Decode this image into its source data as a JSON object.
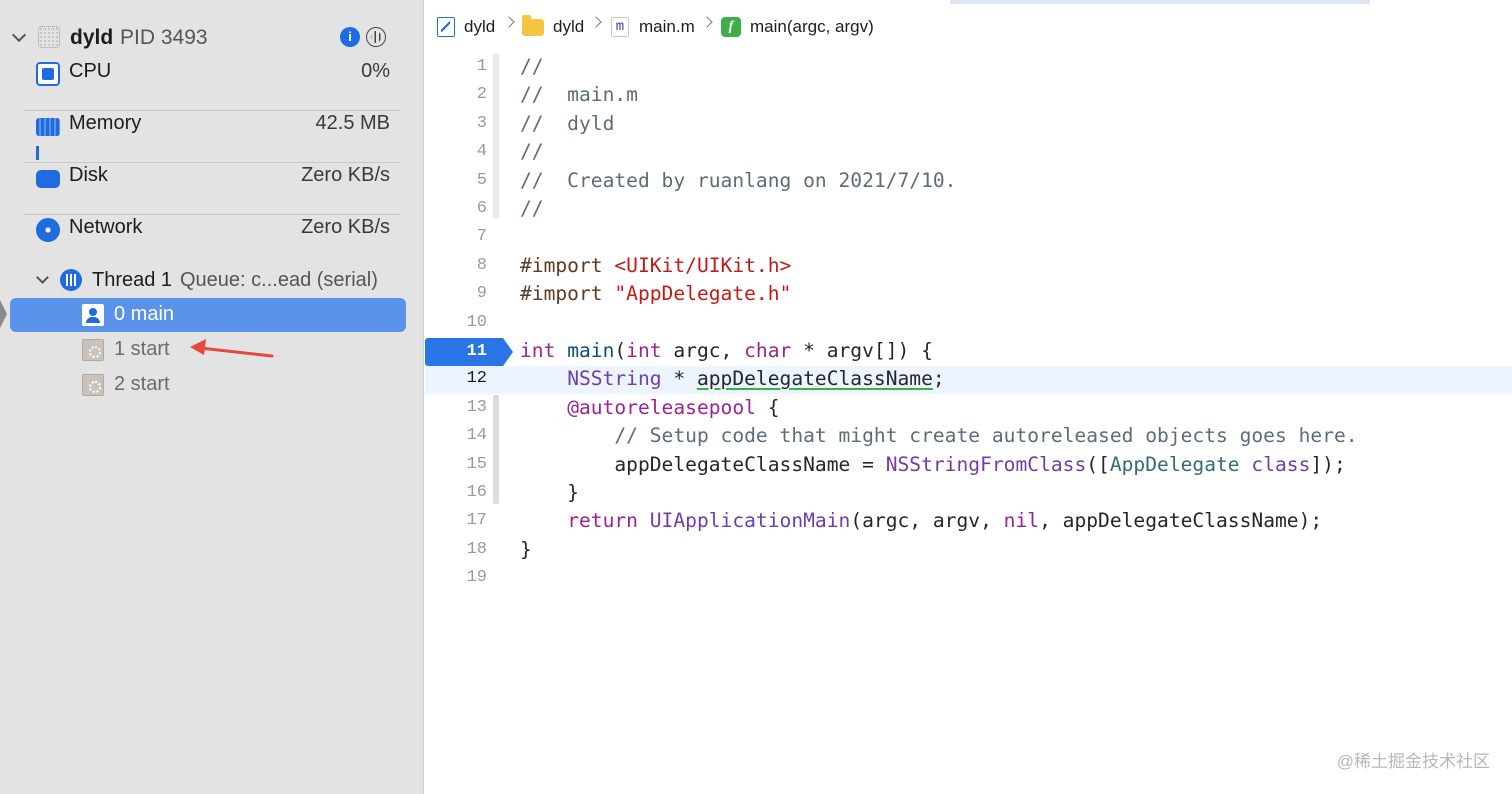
{
  "sidebar": {
    "process": {
      "name": "dyld",
      "pid": "PID 3493"
    },
    "gauges": [
      {
        "label": "CPU",
        "value": "0%"
      },
      {
        "label": "Memory",
        "value": "42.5 MB"
      },
      {
        "label": "Disk",
        "value": "Zero KB/s"
      },
      {
        "label": "Network",
        "value": "Zero KB/s"
      }
    ],
    "thread": {
      "name": "Thread 1",
      "queue": "Queue: c...ead (serial)"
    },
    "frames": [
      {
        "label": "0 main"
      },
      {
        "label": "1 start"
      },
      {
        "label": "2 start"
      }
    ]
  },
  "jump_bar": {
    "crumbs": [
      {
        "label": "dyld",
        "icon": "xcode-project-icon"
      },
      {
        "label": "dyld",
        "icon": "folder-icon"
      },
      {
        "label": "main.m",
        "icon": "objc-file-icon",
        "glyph": "m"
      },
      {
        "label": "main(argc, argv)",
        "icon": "function-icon",
        "glyph": "f"
      }
    ]
  },
  "editor": {
    "line_numbers": [
      "1",
      "2",
      "3",
      "4",
      "5",
      "6",
      "7",
      "8",
      "9",
      "10",
      "11",
      "12",
      "13",
      "14",
      "15",
      "16",
      "17",
      "18",
      "19"
    ],
    "breakpoint_line": "11",
    "current_line": "12",
    "lines": [
      [
        {
          "t": "//",
          "c": "comment"
        }
      ],
      [
        {
          "t": "//  main.m",
          "c": "comment"
        }
      ],
      [
        {
          "t": "//  dyld",
          "c": "comment"
        }
      ],
      [
        {
          "t": "//",
          "c": "comment"
        }
      ],
      [
        {
          "t": "//  Created by ruanlang on 2021/7/10.",
          "c": "comment"
        }
      ],
      [
        {
          "t": "//",
          "c": "comment"
        }
      ],
      [],
      [
        {
          "t": "#import ",
          "c": "pre"
        },
        {
          "t": "<UIKit/UIKit.h>",
          "c": "str"
        }
      ],
      [
        {
          "t": "#import ",
          "c": "pre"
        },
        {
          "t": "\"AppDelegate.h\"",
          "c": "str"
        }
      ],
      [],
      [
        {
          "t": "int",
          "c": "kw"
        },
        {
          "t": " ",
          "c": "id"
        },
        {
          "t": "main",
          "c": "type"
        },
        {
          "t": "(",
          "c": "id"
        },
        {
          "t": "int",
          "c": "kw"
        },
        {
          "t": " argc, ",
          "c": "id"
        },
        {
          "t": "char",
          "c": "kw"
        },
        {
          "t": " * argv[]) {",
          "c": "id"
        }
      ],
      [
        {
          "t": "    ",
          "c": "id"
        },
        {
          "t": "NSString",
          "c": "cls"
        },
        {
          "t": " * ",
          "c": "id"
        },
        {
          "t": "appDelegateClassName",
          "c": "id u"
        },
        {
          "t": ";",
          "c": "id"
        }
      ],
      [
        {
          "t": "    ",
          "c": "id"
        },
        {
          "t": "@autoreleasepool",
          "c": "kw"
        },
        {
          "t": " {",
          "c": "id"
        }
      ],
      [
        {
          "t": "        ",
          "c": "id"
        },
        {
          "t": "// Setup code that might create autoreleased objects goes here.",
          "c": "comment"
        }
      ],
      [
        {
          "t": "        appDelegateClassName = ",
          "c": "id"
        },
        {
          "t": "NSStringFromClass",
          "c": "cls"
        },
        {
          "t": "([",
          "c": "id"
        },
        {
          "t": "AppDelegate",
          "c": "fn"
        },
        {
          "t": " ",
          "c": "id"
        },
        {
          "t": "class",
          "c": "cls"
        },
        {
          "t": "]);",
          "c": "id"
        }
      ],
      [
        {
          "t": "    }",
          "c": "id"
        }
      ],
      [
        {
          "t": "    ",
          "c": "id"
        },
        {
          "t": "return",
          "c": "kw"
        },
        {
          "t": " ",
          "c": "id"
        },
        {
          "t": "UIApplicationMain",
          "c": "cls"
        },
        {
          "t": "(argc, argv, ",
          "c": "id"
        },
        {
          "t": "nil",
          "c": "kw"
        },
        {
          "t": ", appDelegateClassName);",
          "c": "id"
        }
      ],
      [
        {
          "t": "}",
          "c": "id"
        }
      ],
      []
    ]
  },
  "watermark": "@稀土掘金技术社区",
  "colors": {
    "accent": "#1f6ce0",
    "selection": "#5b93ea",
    "breakpoint": "#2a75e6",
    "current_line": "#ecf5fd",
    "annotation_arrow": "#e8473b"
  }
}
